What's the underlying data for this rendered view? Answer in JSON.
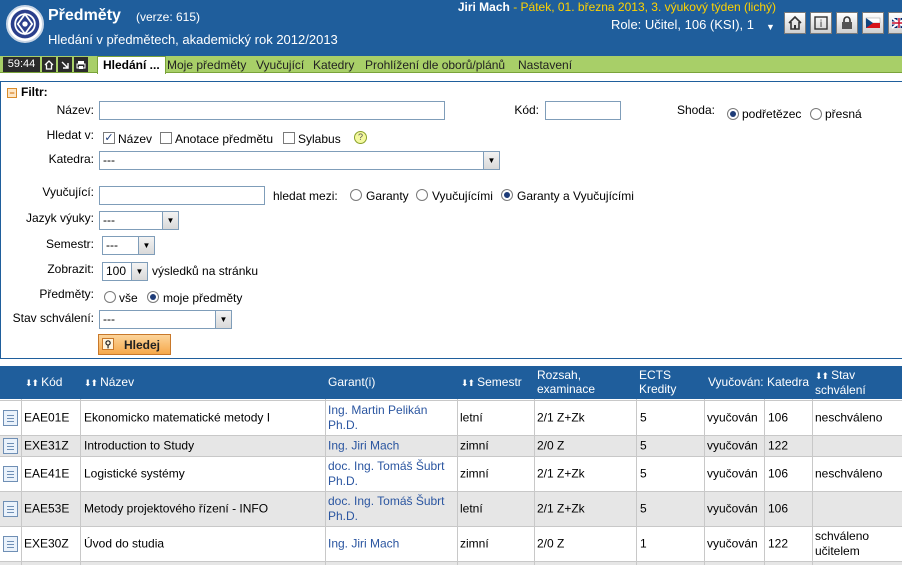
{
  "header": {
    "title": "Předměty",
    "version": "(verze: 615)",
    "subtitle": "Hledání v předmětech, akademický rok 2012/2013",
    "user_name": "Jiri Mach",
    "user_date": " - Pátek, 01. března 2013, 3. výukový týden (lichý)",
    "role": "Role: Učitel, 106 (KSI), 1",
    "icons": [
      "home-icon",
      "info-icon",
      "lock-icon",
      "czech-flag-icon",
      "english-flag-icon"
    ]
  },
  "tabbar": {
    "timer": "59:44",
    "icons": [
      "home-icon",
      "arrow-icon",
      "print-icon"
    ],
    "active_tab": "Hledání ...",
    "tabs": [
      "Moje předměty",
      "Vyučující",
      "Katedry",
      "Prohlížení dle oborů/plánů",
      "Nastavení"
    ]
  },
  "filter": {
    "heading": "Filtr:",
    "nazev_label": "Název:",
    "nazev_value": "",
    "kod_label": "Kód:",
    "kod_value": "",
    "shoda_label": "Shoda:",
    "shoda_options": [
      "podřetězec",
      "přesná"
    ],
    "shoda_selected": "podřetězec",
    "hledat_label": "Hledat v:",
    "hledat_options": [
      {
        "label": "Název",
        "checked": true
      },
      {
        "label": "Anotace předmětu",
        "checked": false
      },
      {
        "label": "Sylabus",
        "checked": false
      }
    ],
    "katedra_label": "Katedra:",
    "katedra_value": "---",
    "vyucujici_label": "Vyučující:",
    "vyucujici_value": "",
    "hledat_mezi_label": "hledat mezi:",
    "hledat_mezi_options": [
      "Garanty",
      "Vyučujícími",
      "Garanty a Vyučujícími"
    ],
    "hledat_mezi_selected": "Garanty a Vyučujícími",
    "jazyk_label": "Jazyk výuky:",
    "jazyk_value": "---",
    "semestr_label": "Semestr:",
    "semestr_value": "---",
    "zobrazit_label": "Zobrazit:",
    "zobrazit_value": "100",
    "zobrazit_suffix": "výsledků na stránku",
    "predmety_label": "Předměty:",
    "predmety_options": [
      "vše",
      "moje předměty"
    ],
    "predmety_selected": "moje předměty",
    "stav_label": "Stav schválení:",
    "stav_value": "---",
    "search_button": "Hledej"
  },
  "table": {
    "headers": {
      "kod": "Kód",
      "nazev": "Název",
      "garant": "Garant(i)",
      "semestr": "Semestr",
      "rozsah": "Rozsah, examinace",
      "ects": "ECTS Kredity",
      "vyucovan": "Vyučován:",
      "katedra": "Katedra",
      "stav": "Stav schválení"
    },
    "rows": [
      {
        "kod": "EAE01E",
        "nazev": "Ekonomicko matematické metody I",
        "garant": "Ing. Martin Pelikán Ph.D.",
        "semestr": "letní",
        "rozsah": "2/1 Z+Zk",
        "ects": "5",
        "vyucovan": "vyučován",
        "katedra": "106",
        "stav": "neschváleno"
      },
      {
        "kod": "EXE31Z",
        "nazev": "Introduction to Study",
        "garant": "Ing. Jiri Mach",
        "semestr": "zimní",
        "rozsah": "2/0 Z",
        "ects": "5",
        "vyucovan": "vyučován",
        "katedra": "122",
        "stav": ""
      },
      {
        "kod": "EAE41E",
        "nazev": "Logistické systémy",
        "garant": "doc. Ing. Tomáš Šubrt Ph.D.",
        "semestr": "zimní",
        "rozsah": "2/1 Z+Zk",
        "ects": "5",
        "vyucovan": "vyučován",
        "katedra": "106",
        "stav": "neschváleno"
      },
      {
        "kod": "EAE53E",
        "nazev": "Metody projektového řízení - INFO",
        "garant": "doc. Ing. Tomáš Šubrt Ph.D.",
        "semestr": "letní",
        "rozsah": "2/1 Z+Zk",
        "ects": "5",
        "vyucovan": "vyučován",
        "katedra": "106",
        "stav": ""
      },
      {
        "kod": "EXE30Z",
        "nazev": "Úvod do studia",
        "garant": "Ing. Jiri Mach",
        "semestr": "zimní",
        "rozsah": "2/0 Z",
        "ects": "1",
        "vyucovan": "vyučován",
        "katedra": "122",
        "stav": "schváleno učitelem"
      }
    ]
  }
}
